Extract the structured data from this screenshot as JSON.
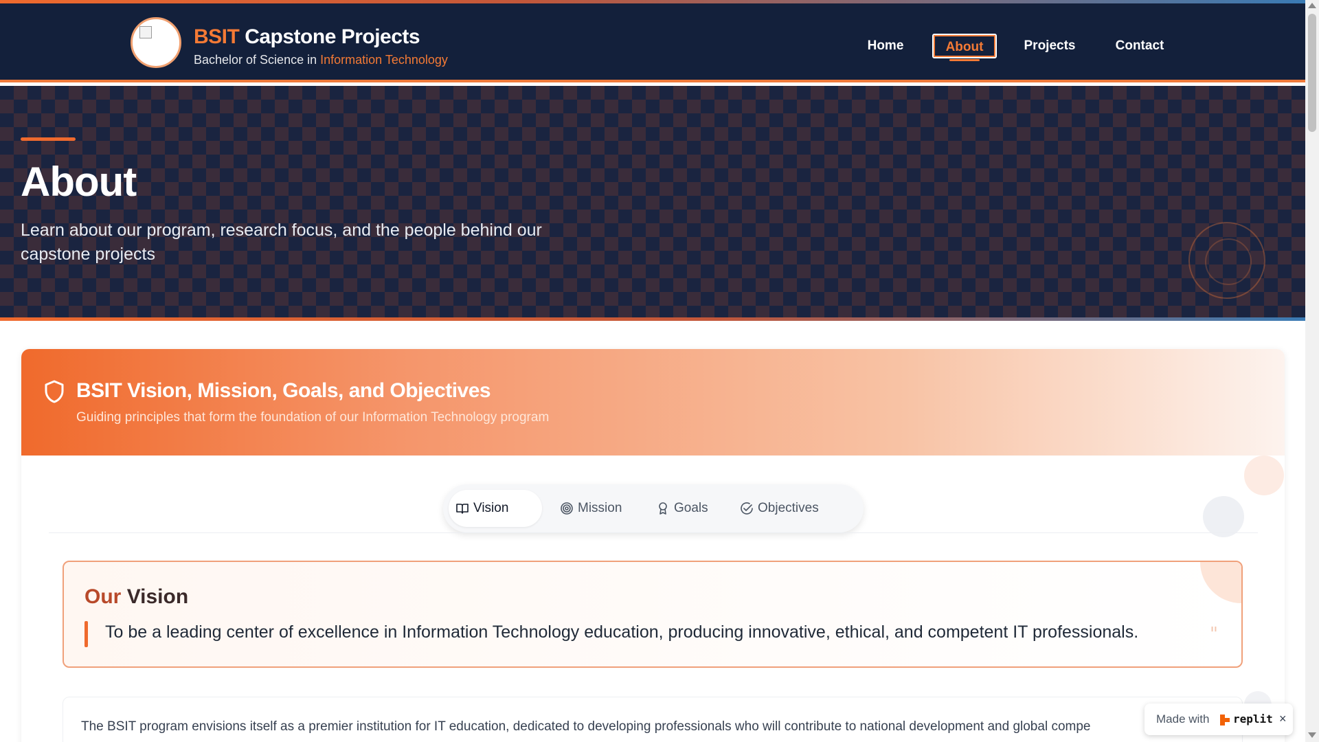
{
  "header": {
    "brand_accent": "BSIT",
    "brand_rest": "Capstone Projects",
    "sub_prefix": "Bachelor of Science in",
    "sub_accent": "Information Technology",
    "nav": [
      {
        "label": "Home",
        "active": false
      },
      {
        "label": "About",
        "active": true
      },
      {
        "label": "Projects",
        "active": false
      },
      {
        "label": "Contact",
        "active": false
      }
    ]
  },
  "hero": {
    "title": "About",
    "description": "Learn about our program, research focus, and the people behind our capstone projects"
  },
  "section": {
    "title": "BSIT Vision, Mission, Goals, and Objectives",
    "subtitle": "Guiding principles that form the foundation of our Information Technology program",
    "tabs": [
      {
        "label": "Vision",
        "icon": "book-open-icon",
        "active": true
      },
      {
        "label": "Mission",
        "icon": "target-icon",
        "active": false
      },
      {
        "label": "Goals",
        "icon": "award-icon",
        "active": false
      },
      {
        "label": "Objectives",
        "icon": "check-circle-icon",
        "active": false
      }
    ],
    "vision": {
      "title_accent": "Our",
      "title_rest": "Vision",
      "statement": "To be a leading center of excellence in Information Technology education, producing innovative, ethical, and competent IT professionals.",
      "quote_mark": "\""
    },
    "body": "The BSIT program envisions itself as a premier institution for IT education, dedicated to developing professionals who will contribute to national development and global compe"
  },
  "badge": {
    "made_with": "Made with",
    "brand": "replit",
    "close": "×"
  },
  "colors": {
    "navy": "#13203b",
    "accent": "#f47a35",
    "vision_title": "#b8492a"
  }
}
